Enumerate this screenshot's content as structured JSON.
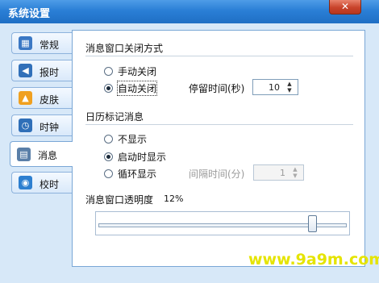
{
  "window": {
    "title": "系统设置",
    "close_glyph": "✕"
  },
  "tabs": [
    {
      "label": "常规",
      "icon": "settings-icon",
      "color": "#3b78c4",
      "glyph": "▦"
    },
    {
      "label": "报时",
      "icon": "speaker-icon",
      "color": "#3170b9",
      "glyph": "◀"
    },
    {
      "label": "皮肤",
      "icon": "shirt-icon",
      "color": "#f0a020",
      "glyph": "▲"
    },
    {
      "label": "时钟",
      "icon": "clock-icon",
      "color": "#2f6fb8",
      "glyph": "◷"
    },
    {
      "label": "消息",
      "icon": "message-icon",
      "color": "#5a7fa8",
      "glyph": "▤"
    },
    {
      "label": "校时",
      "icon": "globe-icon",
      "color": "#2d7fd0",
      "glyph": "◉"
    }
  ],
  "close_section": {
    "title": "消息窗口关闭方式",
    "option_manual": "手动关闭",
    "option_auto": "自动关闭",
    "stay_label": "停留时间(秒)",
    "stay_value": "10"
  },
  "calendar_section": {
    "title": "日历标记消息",
    "option_hide": "不显示",
    "option_startup": "启动时显示",
    "option_loop": "循环显示",
    "interval_label": "间隔时间(分)",
    "interval_value": "1"
  },
  "transparency": {
    "label": "消息窗口透明度",
    "value_text": "12%",
    "value_fraction": 0.12
  },
  "watermark": "www.9a9m.com"
}
